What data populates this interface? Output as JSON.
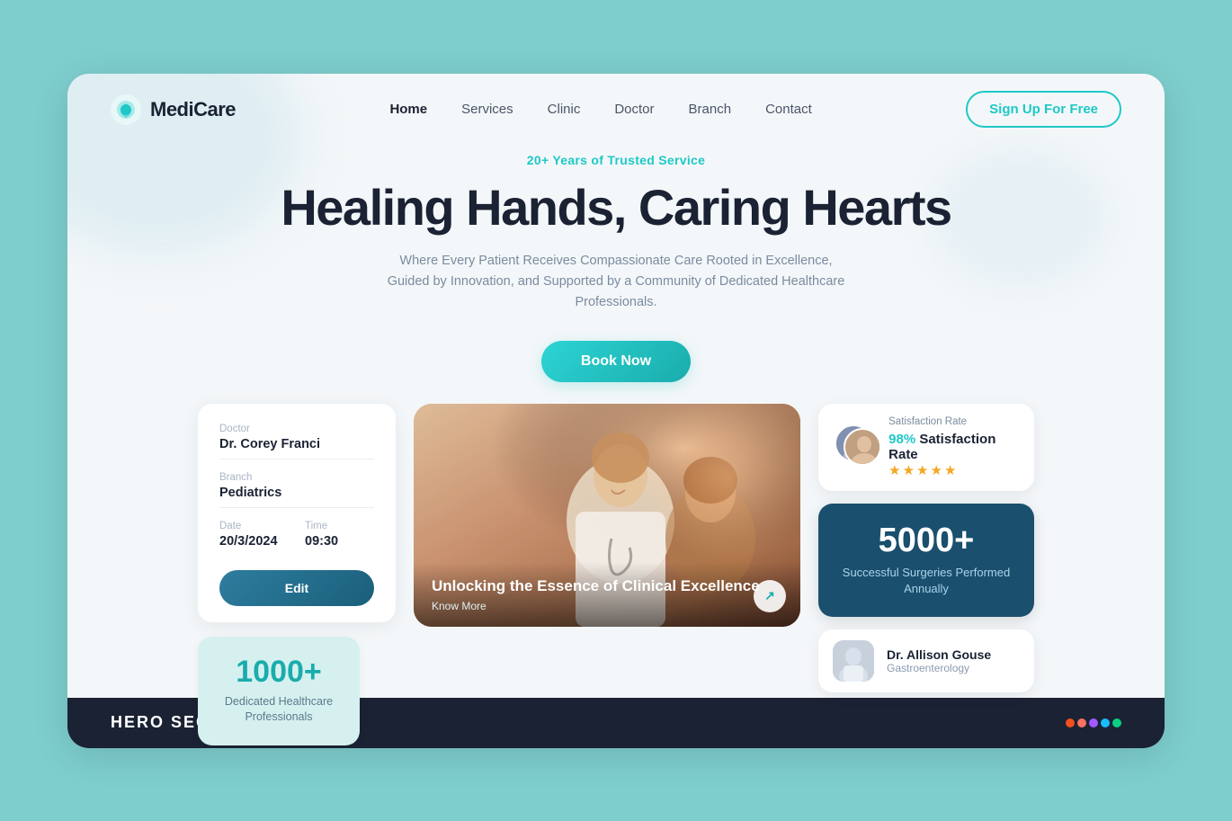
{
  "page": {
    "bg_color": "#7ecece"
  },
  "navbar": {
    "logo_text": "MediCare",
    "nav_links": [
      {
        "label": "Home",
        "active": true
      },
      {
        "label": "Services",
        "active": false
      },
      {
        "label": "Clinic",
        "active": false
      },
      {
        "label": "Doctor",
        "active": false
      },
      {
        "label": "Branch",
        "active": false
      },
      {
        "label": "Contact",
        "active": false
      }
    ],
    "cta_label": "Sign Up For Free"
  },
  "hero": {
    "tagline": "20+ Years of Trusted Service",
    "title": "Healing Hands, Caring Hearts",
    "subtitle": "Where Every Patient Receives Compassionate Care Rooted in Excellence, Guided by Innovation, and Supported by a Community of Dedicated Healthcare Professionals.",
    "book_btn": "Book Now"
  },
  "appointment": {
    "doctor_label": "Doctor",
    "doctor_value": "Dr. Corey Franci",
    "branch_label": "Branch",
    "branch_value": "Pediatrics",
    "date_label": "Date",
    "date_value": "20/3/2024",
    "time_label": "Time",
    "time_value": "09:30",
    "edit_btn": "Edit"
  },
  "stat_left": {
    "number": "1000+",
    "description": "Dedicated Healthcare Professionals"
  },
  "hero_image": {
    "overlay_title": "Unlocking the Essence of Clinical Excellence",
    "overlay_link": "Know More",
    "arrow": "↗"
  },
  "satisfaction": {
    "percentage": "98%",
    "label": "Satisfaction Rate",
    "stars": [
      "★",
      "★",
      "★",
      "★",
      "★"
    ]
  },
  "surgery_stat": {
    "number": "5000+",
    "description": "Successful Surgeries Performed Annually"
  },
  "doctor_card": {
    "name": "Dr. Allison Gouse",
    "specialty": "Gastroenterology"
  },
  "bottom": {
    "label": "HERO SECTION"
  }
}
